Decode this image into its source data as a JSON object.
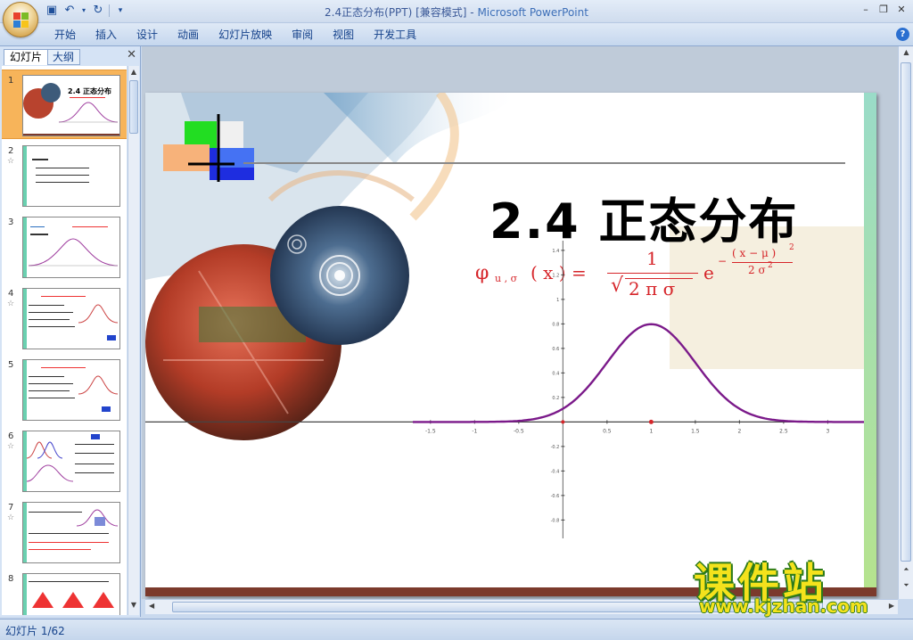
{
  "window": {
    "title": "2.4正态分布(PPT) [兼容模式] - ",
    "app_name": "Microsoft PowerPoint"
  },
  "ribbon": {
    "tabs": [
      "开始",
      "插入",
      "设计",
      "动画",
      "幻灯片放映",
      "审阅",
      "视图",
      "开发工具"
    ]
  },
  "left_panel": {
    "tab_slides": "幻灯片",
    "tab_outline": "大纲",
    "slide_numbers": [
      "1",
      "2",
      "3",
      "4",
      "5",
      "6",
      "7",
      "8"
    ],
    "selected_slide": "1"
  },
  "slide": {
    "title": "2.4  正态分布",
    "formula": {
      "phi": "φ",
      "phi_sub": "u , σ",
      "arg": "( x )  =",
      "numerator": "1",
      "denominator": "2 π σ",
      "base": "e",
      "exp_sign": "−",
      "exp_numerator": "( x − μ )",
      "exp_num_power": "2",
      "exp_denominator": "2 σ",
      "exp_den_power": "2"
    }
  },
  "chart_data": {
    "type": "line",
    "x_ticks": [
      "-1.5",
      "-1",
      "-0.5",
      "0",
      "0.5",
      "1",
      "1.5",
      "2",
      "2.5",
      "3"
    ],
    "y_ticks": [
      "1.4",
      "1.2",
      "1",
      "0.8",
      "0.6",
      "0.4",
      "0.2",
      "-0.2",
      "-0.4",
      "-0.6",
      "-0.8"
    ],
    "xlim": [
      -1.7,
      3.4
    ],
    "ylim": [
      -0.95,
      1.45
    ],
    "mu": 1,
    "sigma": 0.5,
    "series": [
      {
        "color": "#7b1a8a"
      }
    ]
  },
  "status": {
    "slide_indicator": "幻灯片 1/62"
  },
  "watermark": {
    "text": "课件站",
    "url": "www.kjzhan.com"
  }
}
